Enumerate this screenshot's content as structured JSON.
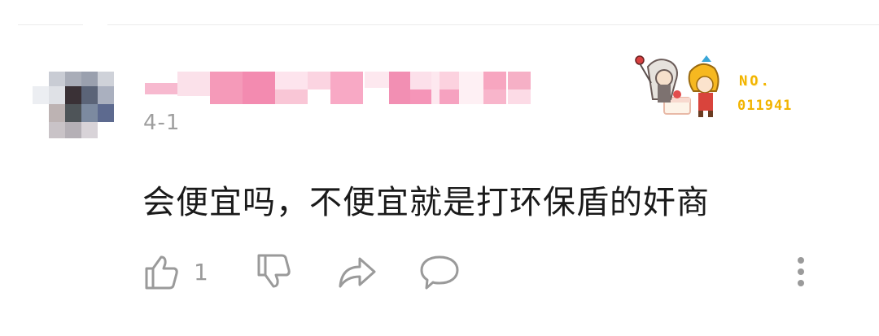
{
  "comment": {
    "date": "4-1",
    "text": "会便宜吗，不便宜就是打环保盾的奸商",
    "like_count": "1"
  },
  "badge": {
    "label": "NO.",
    "number": "011941",
    "color": "#f2b400"
  },
  "icons": {
    "like": "thumbs-up-icon",
    "dislike": "thumbs-down-icon",
    "share": "share-icon",
    "reply": "comment-icon",
    "more": "more-vertical-icon"
  },
  "colors": {
    "icon_gray": "#9a9a9a",
    "text": "#1a1a1a",
    "meta": "#9e9e9e"
  }
}
